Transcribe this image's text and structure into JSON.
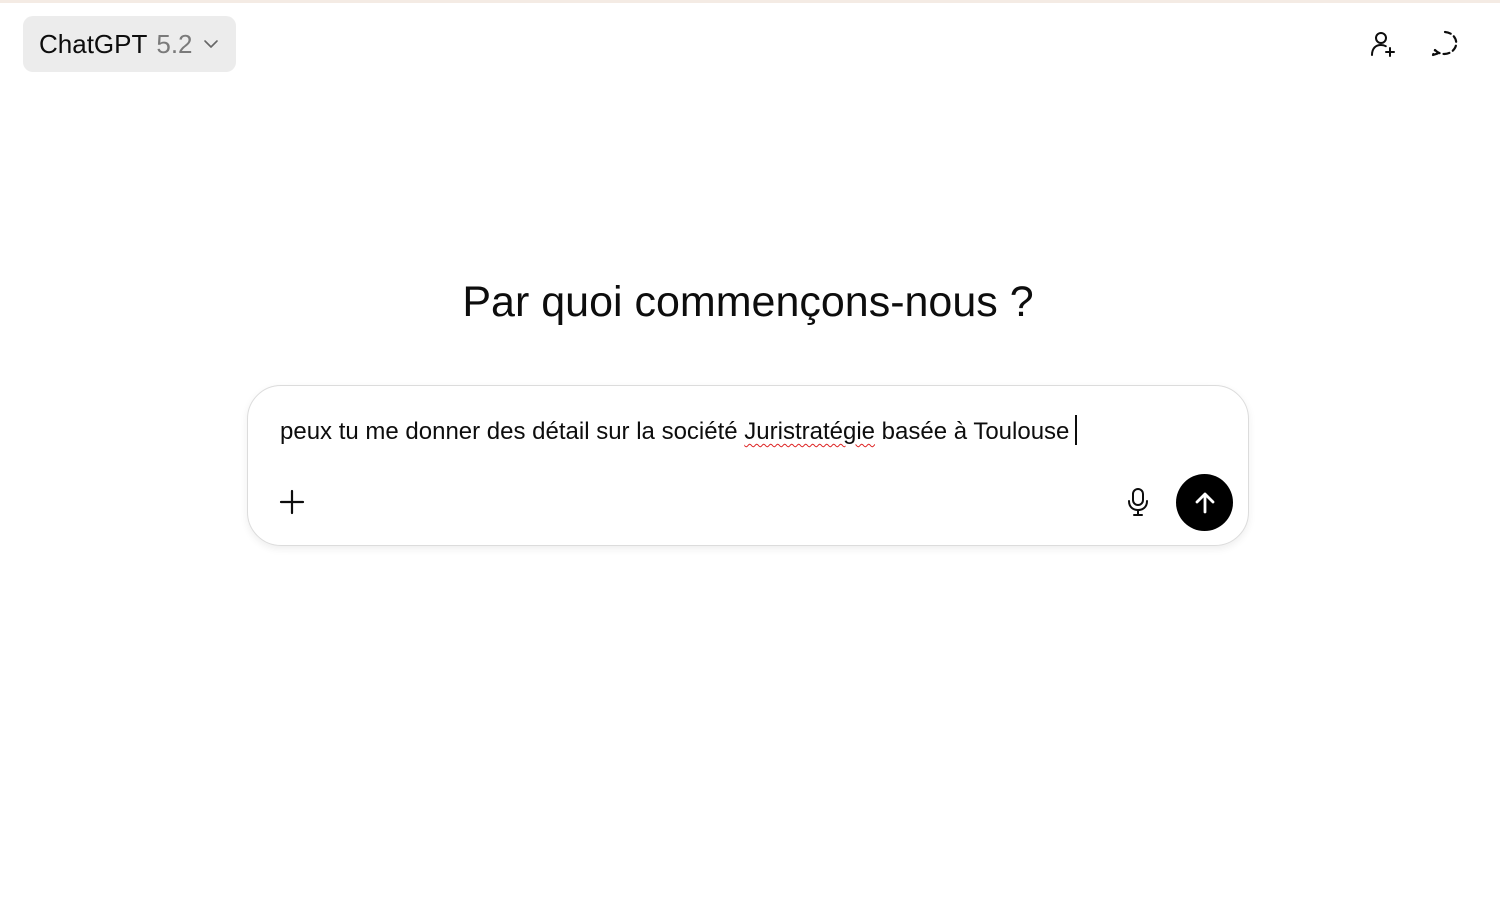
{
  "header": {
    "model_name": "ChatGPT",
    "model_version": "5.2",
    "icons": {
      "model_dropdown": "chevron-down-icon",
      "add_user": "add-user-icon",
      "temporary_chat": "temporary-chat-icon"
    }
  },
  "main": {
    "heading": "Par quoi commençons-nous ?"
  },
  "composer": {
    "text_before": "peux tu me donner des détail sur la société ",
    "misspelled_word": "Juristratégie",
    "text_after": " basée à Toulouse",
    "icons": {
      "attach": "plus-icon",
      "voice": "microphone-icon",
      "send": "arrow-up-icon"
    }
  },
  "colors": {
    "background": "#ffffff",
    "selector_bg": "#ececec",
    "send_button": "#000000",
    "spellcheck_underline": "#dd2222",
    "version_text": "#7a7a7a"
  }
}
